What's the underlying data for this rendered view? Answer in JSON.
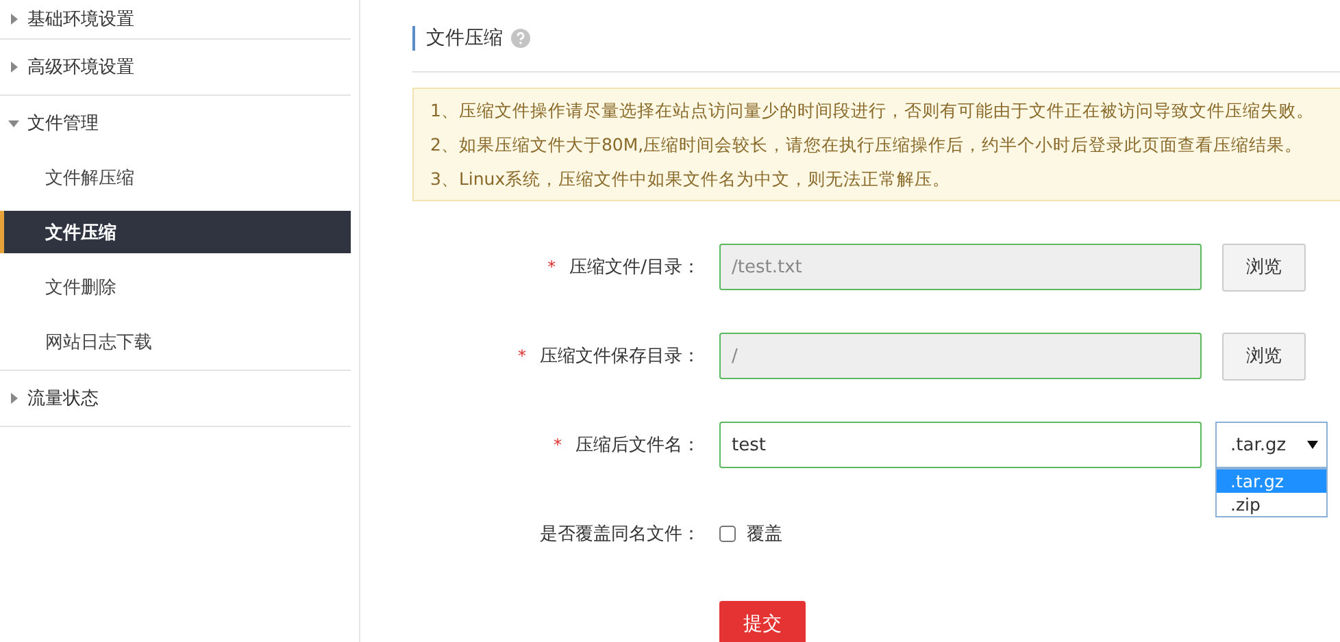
{
  "sidebar": {
    "items": [
      {
        "label": "基础环境设置",
        "expanded": false
      },
      {
        "label": "高级环境设置",
        "expanded": false
      },
      {
        "label": "文件管理",
        "expanded": true,
        "children": [
          {
            "label": "文件解压缩",
            "selected": false
          },
          {
            "label": "文件压缩",
            "selected": true
          },
          {
            "label": "文件删除",
            "selected": false
          },
          {
            "label": "网站日志下载",
            "selected": false
          }
        ]
      },
      {
        "label": "流量状态",
        "expanded": false
      }
    ]
  },
  "page": {
    "title": "文件压缩",
    "notices": [
      "1、压缩文件操作请尽量选择在站点访问量少的时间段进行，否则有可能由于文件正在被访问导致文件压缩失败。",
      "2、如果压缩文件大于80M,压缩时间会较长，请您在执行压缩操作后，约半个小时后登录此页面查看压缩结果。",
      "3、Linux系统，压缩文件中如果文件名为中文，则无法正常解压。"
    ],
    "fields": [
      {
        "kind": "browse",
        "label": "压缩文件/目录：",
        "required": true,
        "value": "/test.txt",
        "disabled": true,
        "button": "浏览"
      },
      {
        "kind": "browse",
        "label": "压缩文件保存目录：",
        "required": true,
        "value": "/",
        "disabled": true,
        "button": "浏览"
      },
      {
        "kind": "select",
        "label": "压缩后文件名：",
        "required": true,
        "value": "test",
        "disabled": false,
        "select": {
          "value": ".tar.gz",
          "expanded": true,
          "options": [
            {
              "label": ".tar.gz",
              "selected": true
            },
            {
              "label": ".zip",
              "selected": false
            }
          ]
        }
      },
      {
        "kind": "checkbox",
        "label": "是否覆盖同名文件：",
        "required": false,
        "option": "覆盖",
        "checked": false
      }
    ],
    "required_mark": "*",
    "submit": "提交"
  }
}
